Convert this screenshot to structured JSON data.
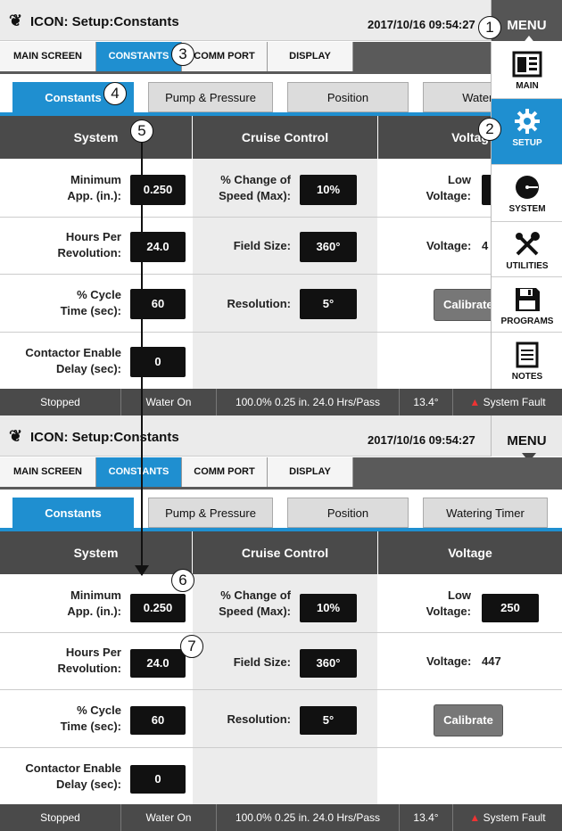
{
  "app": {
    "logo_glyph": "❦",
    "title": "ICON: Setup:Constants",
    "datetime": "2017/10/16 09:54:27",
    "menu_label": "MENU"
  },
  "main_tabs": [
    "MAIN SCREEN",
    "CONSTANTS",
    "COMM PORT",
    "DISPLAY"
  ],
  "sub_tabs_top": [
    "Constants",
    "Pump & Pressure",
    "Position",
    "Watering"
  ],
  "sub_tabs_bottom": [
    "Constants",
    "Pump & Pressure",
    "Position",
    "Watering Timer"
  ],
  "columns": {
    "system": {
      "header": "System",
      "rows": [
        {
          "label_line1": "Minimum",
          "label_line2": "App. (in.):",
          "value": "0.250",
          "value_top_panel": "0.250"
        },
        {
          "label_line1": "Hours Per",
          "label_line2": "Revolution:",
          "value": "24.0"
        },
        {
          "label_line1": "% Cycle",
          "label_line2": "Time (sec):",
          "value": "60"
        },
        {
          "label_line1": "Contactor Enable",
          "label_line2": "Delay (sec):",
          "value": "0"
        }
      ]
    },
    "cruise": {
      "header": "Cruise Control",
      "rows": [
        {
          "label_line1": "% Change of",
          "label_line2": "Speed (Max):",
          "value": "10%"
        },
        {
          "label_line1": "Field Size:",
          "value": "360°"
        },
        {
          "label_line1": "Resolution:",
          "value": "5°"
        }
      ]
    },
    "voltage": {
      "header": "Voltage",
      "header_top_panel": "Voltag",
      "low_label_line1": "Low",
      "low_label_line2": "Voltage:",
      "low_value": "250",
      "voltage_label": "Voltage:",
      "voltage_value": "447",
      "voltage_value_top_panel": "4",
      "calibrate_label": "Calibrate",
      "calibrate_label_top_panel": "Calibrate"
    }
  },
  "status": {
    "state": "Stopped",
    "water": "Water On",
    "info": "100.0%  0.25 in.  24.0 Hrs/Pass",
    "angle": "13.4°",
    "fault_icon": "warning-triangle",
    "fault": "System Fault"
  },
  "side_menu": {
    "items": [
      {
        "label": "MAIN",
        "icon": "main-screen-icon"
      },
      {
        "label": "SETUP",
        "icon": "gear-icon"
      },
      {
        "label": "SYSTEM",
        "icon": "system-dial-icon"
      },
      {
        "label": "UTILITIES",
        "icon": "tools-icon"
      },
      {
        "label": "PROGRAMS",
        "icon": "floppy-icon"
      },
      {
        "label": "NOTES",
        "icon": "notes-icon"
      }
    ]
  },
  "callouts": [
    "1",
    "2",
    "3",
    "4",
    "5",
    "6",
    "7"
  ],
  "colors": {
    "accent": "#1f8fd0",
    "header_dark": "#4a4a4a",
    "value_box": "#111111",
    "fault_red": "#e33333"
  }
}
